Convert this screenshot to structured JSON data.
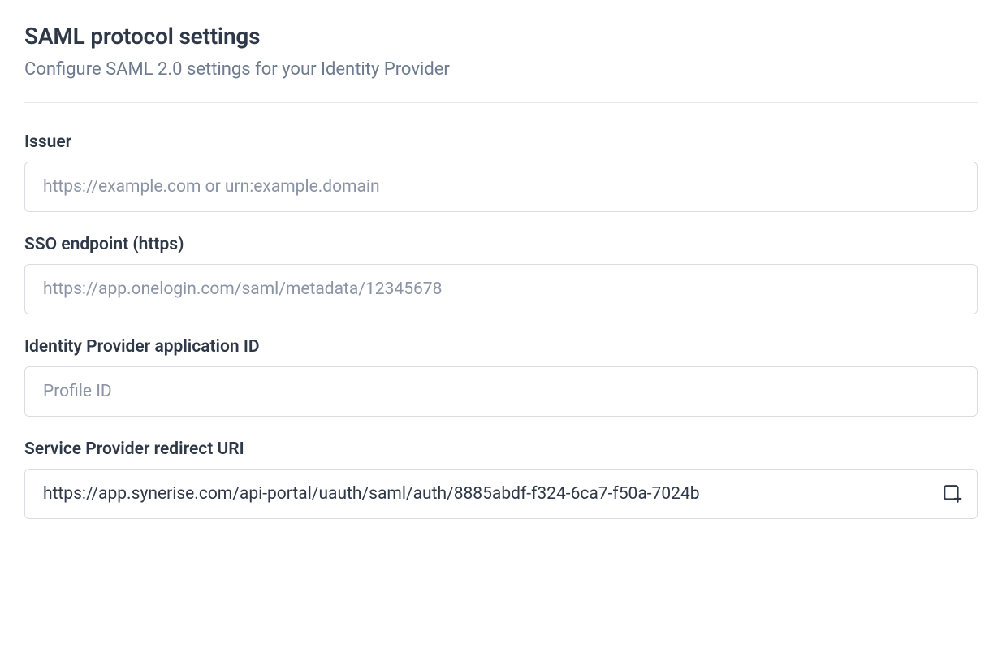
{
  "header": {
    "title": "SAML protocol settings",
    "subtitle": "Configure SAML 2.0 settings for your Identity Provider"
  },
  "fields": {
    "issuer": {
      "label": "Issuer",
      "placeholder": "https://example.com or urn:example.domain",
      "value": ""
    },
    "sso_endpoint": {
      "label": "SSO endpoint (https)",
      "placeholder": "https://app.onelogin.com/saml/metadata/12345678",
      "value": ""
    },
    "idp_app_id": {
      "label": "Identity Provider application ID",
      "placeholder": "Profile ID",
      "value": ""
    },
    "sp_redirect_uri": {
      "label": "Service Provider redirect URI",
      "value": "https://app.synerise.com/api-portal/uauth/saml/auth/8885abdf-f324-6ca7-f50a-7024b"
    }
  }
}
